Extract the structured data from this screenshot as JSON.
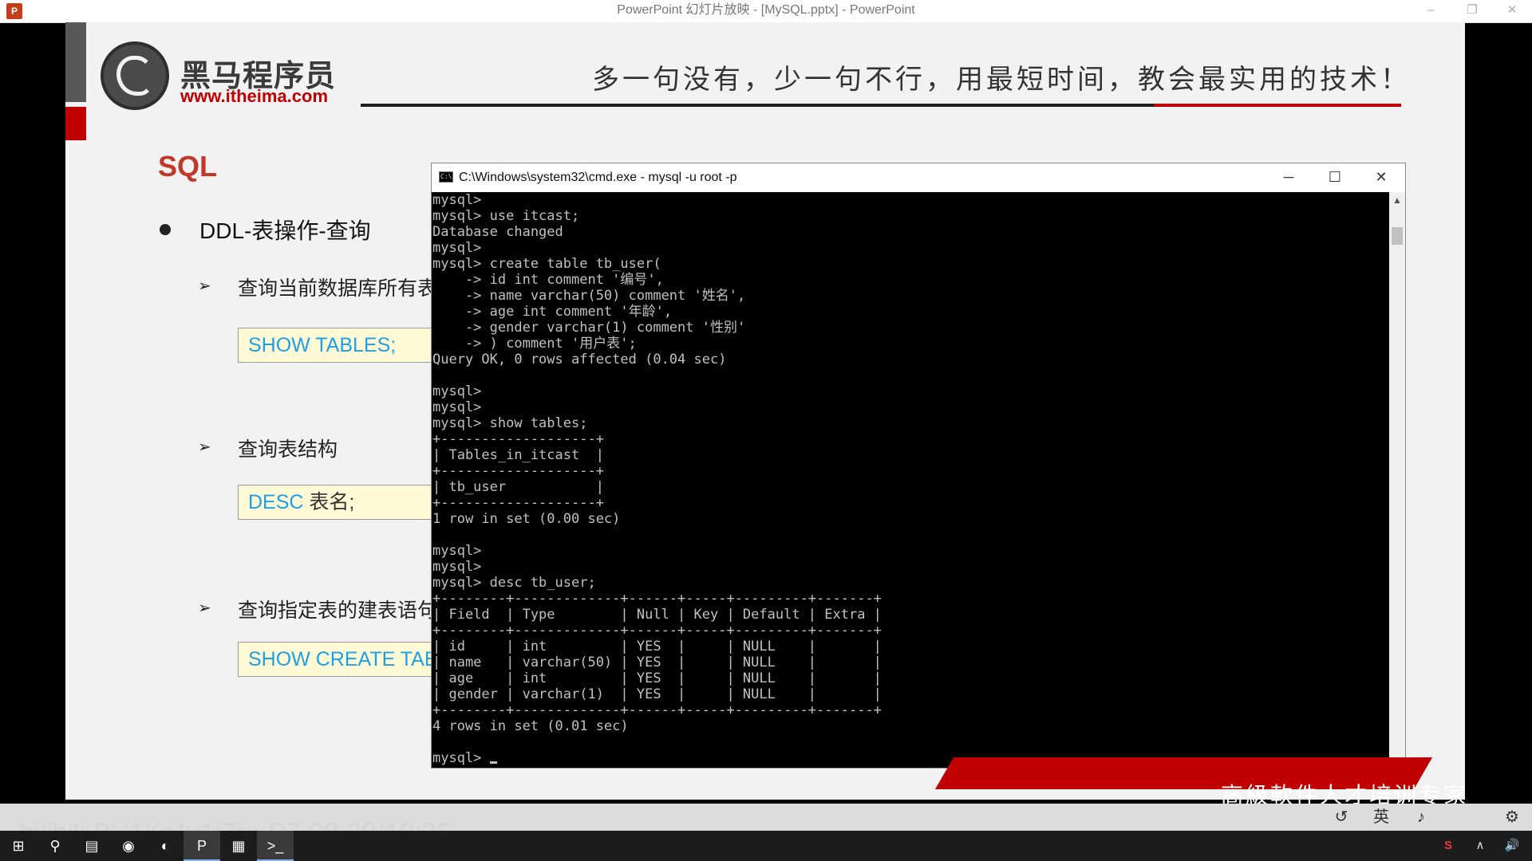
{
  "window": {
    "title": "PowerPoint 幻灯片放映 - [MySQL.pptx] - PowerPoint",
    "app_icon": "P",
    "minimize_icon": "–",
    "restore_icon": "❐",
    "close_icon": "✕"
  },
  "slide": {
    "logo_cn": "黑马程序员",
    "logo_url": "www.itheima.com",
    "slogan": "多一句没有，少一句不行，用最短时间，教会最实用的技术！",
    "heading": "SQL",
    "bullet": "DDL-表操作-查询",
    "arrow_glyph": "➢",
    "items": [
      {
        "label": "查询当前数据库所有表",
        "code_keyword": "SHOW TABLES;",
        "code_rest": ""
      },
      {
        "label": "查询表结构",
        "code_keyword": "DESC",
        "code_rest": " 表名;"
      },
      {
        "label": "查询指定表的建表语句",
        "code_keyword": "SHOW CREATE TABLE",
        "code_rest": ""
      }
    ],
    "banner_text": "高級軟件人才培训专家"
  },
  "cmd": {
    "title": "C:\\Windows\\system32\\cmd.exe - mysql  -u root -p",
    "minimize_icon": "─",
    "maximize_icon": "☐",
    "close_icon": "✕",
    "output": "mysql>\nmysql> use itcast;\nDatabase changed\nmysql>\nmysql> create table tb_user(\n    -> id int comment '编号',\n    -> name varchar(50) comment '姓名',\n    -> age int comment '年龄',\n    -> gender varchar(1) comment '性别'\n    -> ) comment '用户表';\nQuery OK, 0 rows affected (0.04 sec)\n\nmysql>\nmysql>\nmysql> show tables;\n+-------------------+\n| Tables_in_itcast  |\n+-------------------+\n| tb_user           |\n+-------------------+\n1 row in set (0.00 sec)\n\nmysql>\nmysql>\nmysql> desc tb_user;\n+--------+-------------+------+-----+---------+-------+\n| Field  | Type        | Null | Key | Default | Extra |\n+--------+-------------+------+-----+---------+-------+\n| id     | int         | YES  |     | NULL    |       |\n| name   | varchar(50) | YES  |     | NULL    |       |\n| age    | int         | YES  |     | NULL    |       |\n| gender | varchar(1)  | YES  |     | NULL    |       |\n+--------+-------------+------+-----+---------+-------+\n4 rows in set (0.01 sec)\n\n",
    "prompt": "mysql> ",
    "scroll_up_icon": "▲",
    "scroll_down_icon": "▼"
  },
  "watermark": "bilibili  BV1Kr4y1i7ru  P7  08:38/10:35",
  "slideshow_controls": [
    "↺",
    "英",
    "♪",
    "⚙"
  ],
  "taskbar": {
    "items": [
      "⊞",
      "⚲",
      "▤",
      "◉",
      "◐",
      "P",
      "▦",
      ">_"
    ],
    "tray": [
      "S",
      "∧",
      "🔊"
    ]
  }
}
